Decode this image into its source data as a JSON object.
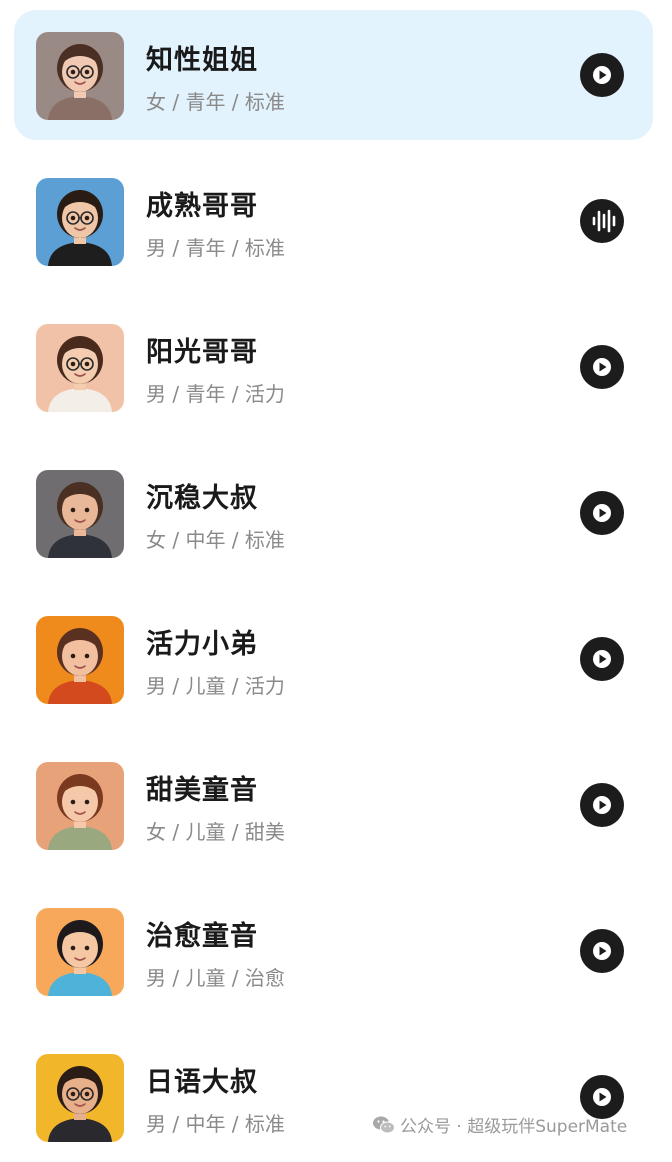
{
  "voices": [
    {
      "name": "知性姐姐",
      "tags": "女 / 青年 / 标准",
      "selected": true,
      "state": "play",
      "avatar": {
        "bg": "#9a8a86",
        "skin": "#f1c9b2",
        "hair": "#4a2f25",
        "shirt": "#8a6f66",
        "glasses": true
      }
    },
    {
      "name": "成熟哥哥",
      "tags": "男 / 青年 / 标准",
      "selected": false,
      "state": "playing",
      "avatar": {
        "bg": "#5b9fd4",
        "skin": "#f0c6a8",
        "hair": "#2a1c15",
        "shirt": "#1e1e1e",
        "glasses": true
      }
    },
    {
      "name": "阳光哥哥",
      "tags": "男 / 青年 / 活力",
      "selected": false,
      "state": "play",
      "avatar": {
        "bg": "#f2c2a8",
        "skin": "#f4cdb0",
        "hair": "#4a2a1c",
        "shirt": "#f3efe8",
        "glasses": true
      }
    },
    {
      "name": "沉稳大叔",
      "tags": "女 / 中年 / 标准",
      "selected": false,
      "state": "play",
      "avatar": {
        "bg": "#6f6d70",
        "skin": "#e8b898",
        "hair": "#4a3022",
        "shirt": "#2f3238",
        "glasses": false
      }
    },
    {
      "name": "活力小弟",
      "tags": "男 / 儿童 / 活力",
      "selected": false,
      "state": "play",
      "avatar": {
        "bg": "#ef8a1c",
        "skin": "#f2c09e",
        "hair": "#5a3020",
        "shirt": "#d24a1e",
        "glasses": false
      }
    },
    {
      "name": "甜美童音",
      "tags": "女 / 儿童 / 甜美",
      "selected": false,
      "state": "play",
      "avatar": {
        "bg": "#e8a27a",
        "skin": "#f4c8a8",
        "hair": "#7a3a20",
        "shirt": "#9aa880",
        "glasses": false
      }
    },
    {
      "name": "治愈童音",
      "tags": "男 / 儿童 / 治愈",
      "selected": false,
      "state": "play",
      "avatar": {
        "bg": "#f7a85a",
        "skin": "#f5c7a2",
        "hair": "#1e1a1c",
        "shirt": "#4fb2d8",
        "glasses": false
      }
    },
    {
      "name": "日语大叔",
      "tags": "男 / 中年 / 标准",
      "selected": false,
      "state": "play",
      "avatar": {
        "bg": "#f2b62a",
        "skin": "#e8b08a",
        "hair": "#2a1d18",
        "shirt": "#2a2a2e",
        "glasses": true
      }
    }
  ],
  "watermark": {
    "text": "公众号 · 超级玩伴SuperMate",
    "icon": "wechat-icon"
  }
}
